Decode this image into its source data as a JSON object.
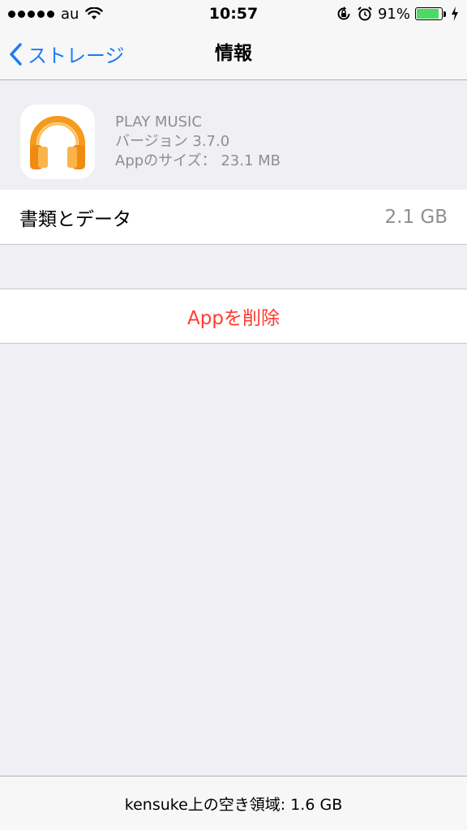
{
  "status_bar": {
    "carrier": "au",
    "time": "10:57",
    "battery_percent": "91%",
    "battery_level": 0.91,
    "icons": [
      "signal-dots",
      "wifi-icon",
      "rotation-lock-icon",
      "alarm-icon",
      "battery-icon",
      "charging-icon"
    ]
  },
  "nav": {
    "back_label": "ストレージ",
    "title": "情報"
  },
  "app": {
    "name": "PLAY MUSIC",
    "version": "バージョン 3.7.0",
    "size": "Appのサイズ： 23.1 MB",
    "icon": "headphones-icon"
  },
  "documents": {
    "label": "書類とデータ",
    "value": "2.1 GB"
  },
  "delete_label": "Appを削除",
  "footer": {
    "free_space": "kensuke上の空き領域: 1.6 GB"
  },
  "colors": {
    "accent": "#1a7cf5",
    "destructive": "#ff3b30",
    "battery": "#4cd964",
    "icon_orange": "#f59a1b"
  }
}
